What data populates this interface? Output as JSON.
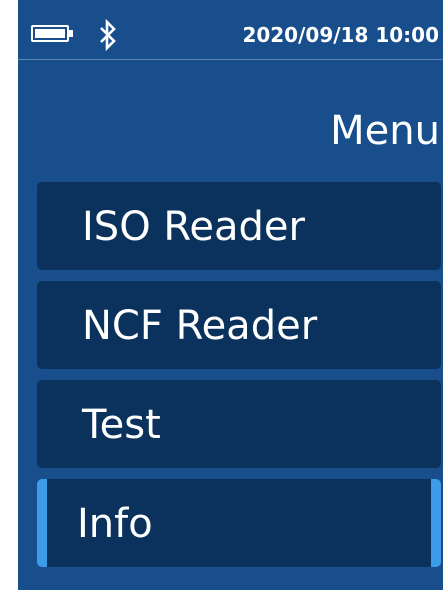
{
  "status_bar": {
    "battery_icon": "battery-full-icon",
    "bluetooth_icon": "bluetooth-icon",
    "datetime": "2020/09/18 10:00"
  },
  "page_title": "Menu",
  "menu": {
    "items": [
      {
        "label": "ISO Reader",
        "selected": false
      },
      {
        "label": "NCF Reader",
        "selected": false
      },
      {
        "label": "Test",
        "selected": false
      },
      {
        "label": "Info",
        "selected": true
      }
    ]
  },
  "colors": {
    "background": "#184e8c",
    "menu_item": "#0b325d",
    "selection_accent": "#3d9be9",
    "text": "#ffffff"
  }
}
